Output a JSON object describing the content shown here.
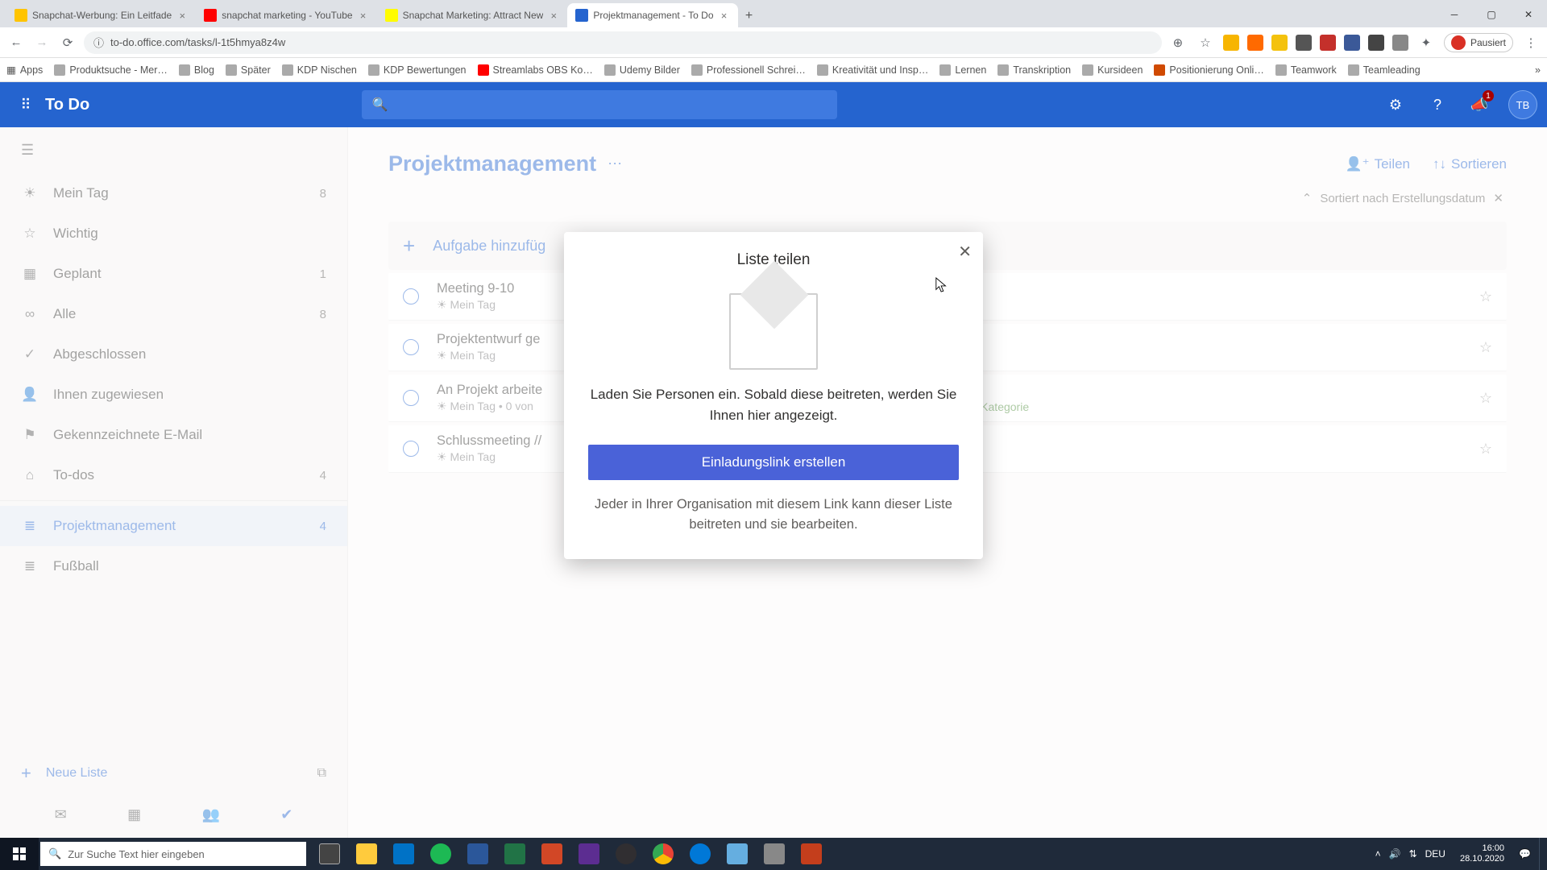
{
  "browser": {
    "tabs": [
      {
        "title": "Snapchat-Werbung: Ein Leitfade",
        "active": false
      },
      {
        "title": "snapchat marketing - YouTube",
        "active": false
      },
      {
        "title": "Snapchat Marketing: Attract New",
        "active": false
      },
      {
        "title": "Projektmanagement - To Do",
        "active": true
      }
    ],
    "url": "to-do.office.com/tasks/l-1t5hmya8z4w",
    "profile_status": "Pausiert",
    "bookmarks": [
      "Apps",
      "Produktsuche - Mer…",
      "Blog",
      "Später",
      "KDP Nischen",
      "KDP Bewertungen",
      "Streamlabs OBS Ko…",
      "Udemy Bilder",
      "Professionell Schrei…",
      "Kreativität und Insp…",
      "Lernen",
      "Transkription",
      "Kursideen",
      "Positionierung Onli…",
      "Teamwork",
      "Teamleading"
    ]
  },
  "app": {
    "title": "To Do",
    "avatar": "TB",
    "notification_count": "1"
  },
  "sidebar": {
    "items": [
      {
        "icon": "☀",
        "label": "Mein Tag",
        "count": "8"
      },
      {
        "icon": "☆",
        "label": "Wichtig",
        "count": ""
      },
      {
        "icon": "▦",
        "label": "Geplant",
        "count": "1"
      },
      {
        "icon": "∞",
        "label": "Alle",
        "count": "8"
      },
      {
        "icon": "✓",
        "label": "Abgeschlossen",
        "count": ""
      },
      {
        "icon": "👤",
        "label": "Ihnen zugewiesen",
        "count": ""
      },
      {
        "icon": "⚑",
        "label": "Gekennzeichnete E-Mail",
        "count": ""
      },
      {
        "icon": "⌂",
        "label": "To-dos",
        "count": "4"
      }
    ],
    "lists": [
      {
        "icon": "≣",
        "label": "Projektmanagement",
        "count": "4",
        "selected": true
      },
      {
        "icon": "≣",
        "label": "Fußball",
        "count": ""
      }
    ],
    "new_list": "Neue Liste"
  },
  "main": {
    "title": "Projektmanagement",
    "share": "Teilen",
    "sort": "Sortieren",
    "sorted_by": "Sortiert nach Erstellungsdatum",
    "add_placeholder": "Aufgabe hinzufüg",
    "tasks": [
      {
        "name": "Meeting 9-10",
        "meta": "☀ Mein Tag"
      },
      {
        "name": "Projektentwurf ge",
        "meta": "☀ Mein Tag"
      },
      {
        "name": "An Projekt arbeite",
        "meta": "☀ Mein Tag  •  0 von",
        "extra": "üne Kategorie"
      },
      {
        "name": "Schlussmeeting //",
        "meta": "☀ Mein Tag"
      }
    ]
  },
  "modal": {
    "title": "Liste teilen",
    "description": "Laden Sie Personen ein. Sobald diese beitreten, werden Sie Ihnen hier angezeigt.",
    "button": "Einladungslink erstellen",
    "subtext": "Jeder in Ihrer Organisation mit diesem Link kann dieser Liste beitreten und sie bearbeiten."
  },
  "taskbar": {
    "search_placeholder": "Zur Suche Text hier eingeben",
    "time": "16:00",
    "date": "28.10.2020",
    "lang": "DEU"
  }
}
